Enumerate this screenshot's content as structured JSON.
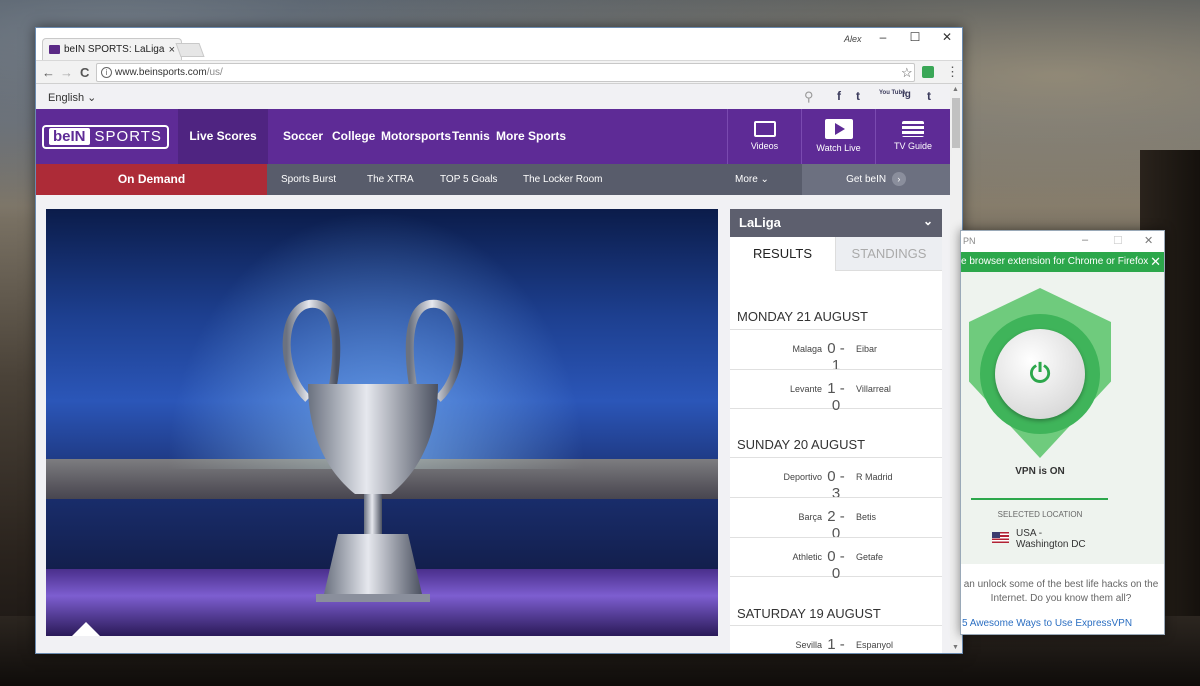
{
  "browser": {
    "tab_title": "beIN SPORTS: LaLiga, Lig",
    "tab_close": "×",
    "user": "Alex",
    "minimize": "–",
    "maximize": "☐",
    "close": "✕",
    "back": "←",
    "forward": "→",
    "reload": "C",
    "url_host": "www.beinsports.com",
    "url_path": "/us/",
    "star": "☆",
    "menu": "⋮"
  },
  "site": {
    "language": "English",
    "language_chevron": "⌄",
    "social": [
      "f",
      "t",
      "You Tube",
      "ig",
      "t"
    ],
    "logo_bein": "beIN",
    "logo_sports": "SPORTS",
    "live_scores": "Live Scores",
    "nav": [
      "Soccer",
      "College",
      "Motorsports",
      "Tennis",
      "More Sports"
    ],
    "tiles": [
      {
        "label": "Videos",
        "icon": "videos-icon"
      },
      {
        "label": "Watch Live",
        "icon": "watch-live-icon"
      },
      {
        "label": "TV Guide",
        "icon": "tv-guide-icon"
      }
    ],
    "on_demand": "On Demand",
    "subnav": [
      "Sports Burst",
      "The XTRA",
      "TOP 5 Goals",
      "The Locker Room"
    ],
    "more": "More ⌄",
    "get_bein": "Get beIN",
    "get_bein_arrow": "›"
  },
  "sidebar": {
    "league": "LaLiga",
    "chevron": "⌄",
    "tab_results": "RESULTS",
    "tab_standings": "STANDINGS",
    "days": [
      {
        "label": "MONDAY 21 AUGUST",
        "matches": [
          {
            "home": "Malaga",
            "score": "0 - 1",
            "away": "Eibar"
          },
          {
            "home": "Levante",
            "score": "1 - 0",
            "away": "Villarreal"
          }
        ]
      },
      {
        "label": "SUNDAY 20 AUGUST",
        "matches": [
          {
            "home": "Deportivo",
            "score": "0 - 3",
            "away": "R Madrid"
          },
          {
            "home": "Barça",
            "score": "2 - 0",
            "away": "Betis"
          },
          {
            "home": "Athletic",
            "score": "0 - 0",
            "away": "Getafe"
          }
        ]
      },
      {
        "label": "SATURDAY 19 AUGUST",
        "matches": [
          {
            "home": "Sevilla",
            "score": "1 - 1",
            "away": "Espanyol"
          }
        ]
      }
    ]
  },
  "vpn": {
    "title": "PN",
    "banner": "e browser extension for Chrome or Firefox",
    "banner_close": "✕",
    "power_symbol": "⏻",
    "status": "VPN is ON",
    "selected_location_label": "SELECTED LOCATION",
    "location_line1": "USA -",
    "location_line2": "Washington DC",
    "tip": "an unlock some of the best life hacks on the Internet. Do you know them all?",
    "link": "5 Awesome Ways to Use ExpressVPN"
  }
}
